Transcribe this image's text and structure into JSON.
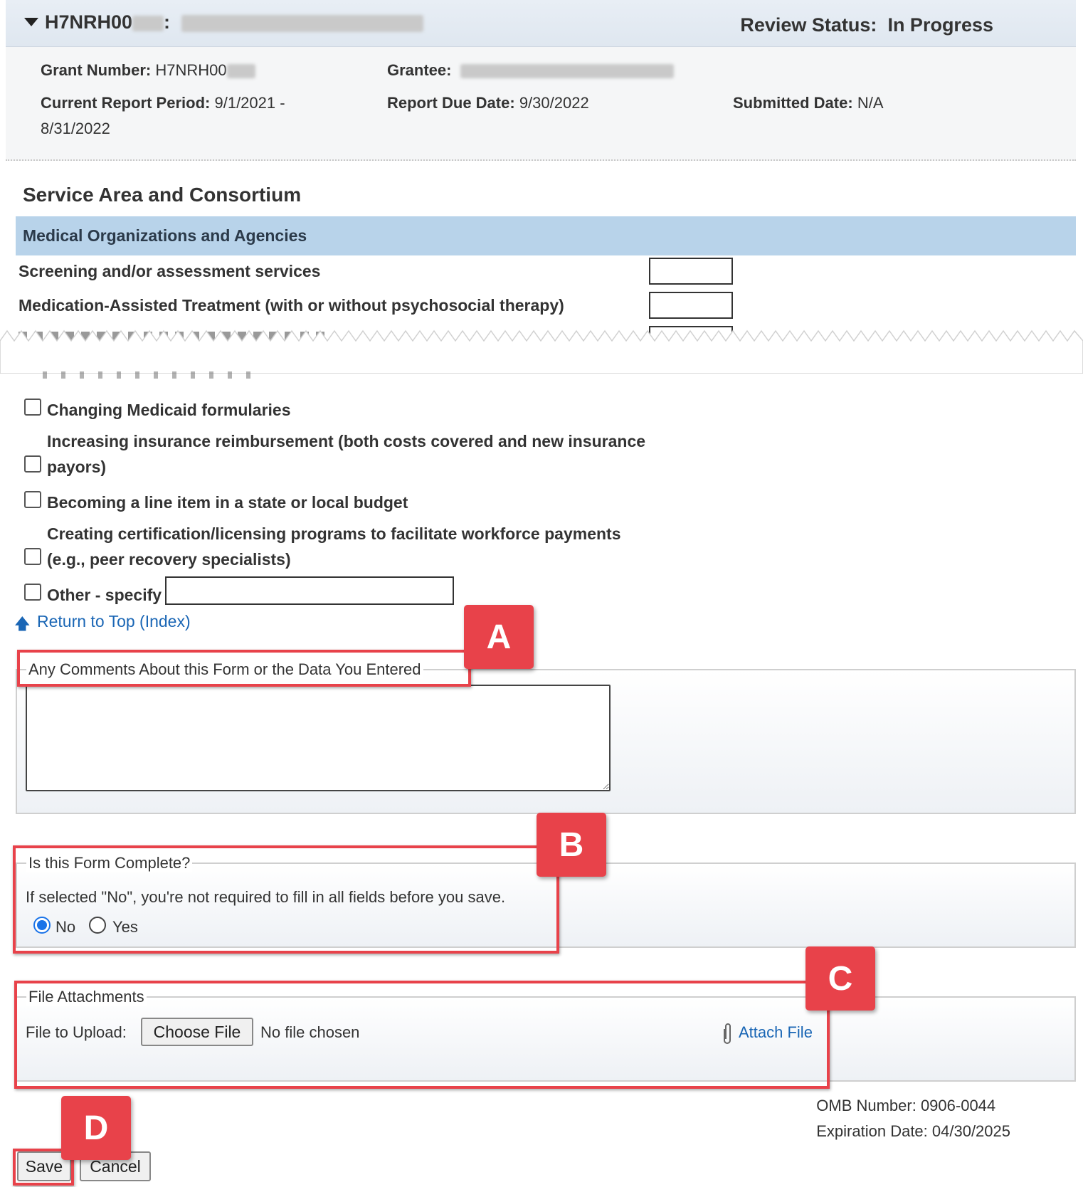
{
  "header": {
    "grant_id_prefix": "H7NRH00",
    "separator": ":",
    "review_status_label": "Review Status:",
    "review_status_value": "In Progress"
  },
  "info": {
    "grant_number_label": "Grant Number:",
    "grant_number_value": "H7NRH00",
    "grantee_label": "Grantee:",
    "period_label": "Current Report Period:",
    "period_value_line1": "9/1/2021 -",
    "period_value_line2": "8/31/2022",
    "due_label": "Report Due Date:",
    "due_value": "9/30/2022",
    "submitted_label": "Submitted Date:",
    "submitted_value": "N/A"
  },
  "section": {
    "title": "Service Area and Consortium",
    "subheader": "Medical Organizations and Agencies",
    "rows": [
      "Screening and/or assessment services",
      "Medication-Assisted Treatment (with or without psychosocial therapy)"
    ]
  },
  "checkbox_options": {
    "medicaid": "Changing Medicaid formularies",
    "insurance_line1": "Increasing insurance reimbursement (both costs covered and new insurance",
    "insurance_line2": "payors)",
    "budget": "Becoming a line item in a state or local budget",
    "cert_line1": "Creating certification/licensing programs to facilitate workforce payments",
    "cert_line2": "(e.g., peer recovery specialists)",
    "other": "Other - specify"
  },
  "return_link": "Return to Top (Index)",
  "comments": {
    "legend": "Any Comments About this Form or the Data You Entered"
  },
  "complete": {
    "legend": "Is this Form Complete?",
    "hint": "If selected \"No\", you're not required to fill in all fields before you save.",
    "option_no": "No",
    "option_yes": "Yes",
    "selected": "No"
  },
  "attachments": {
    "legend": "File Attachments",
    "upload_label": "File to Upload:",
    "choose_button": "Choose File",
    "no_file_text": "No file chosen",
    "attach_link": "Attach File"
  },
  "footer": {
    "omb_number": "OMB Number: 0906-0044",
    "expiration": "Expiration Date: 04/30/2025",
    "save_button": "Save",
    "cancel_button": "Cancel"
  },
  "annotations": {
    "a": "A",
    "b": "B",
    "c": "C",
    "d": "D",
    "color": "#e8424a"
  }
}
